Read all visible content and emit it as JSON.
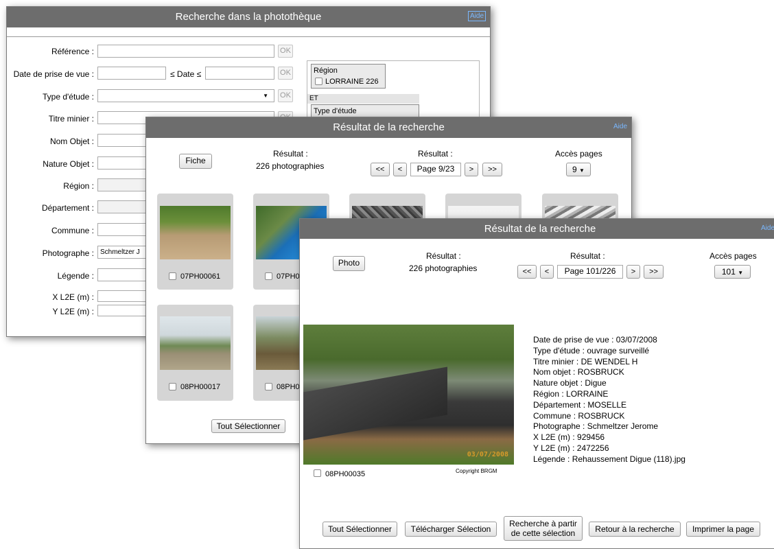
{
  "search": {
    "title": "Recherche dans la photothèque",
    "aide": "Aide",
    "labels": {
      "reference": "Référence :",
      "date": "Date de prise de vue :",
      "date_between": "≤ Date ≤",
      "type_etude": "Type d'étude :",
      "titre_minier": "Titre minier :",
      "nom_objet": "Nom Objet :",
      "nature_objet": "Nature Objet :",
      "region": "Région :",
      "departement": "Département :",
      "commune": "Commune :",
      "photographe": "Photographe :",
      "legende": "Légende :",
      "x": "X L2E (m) :",
      "y": "Y L2E (m) :"
    },
    "ok": "OK",
    "photographe_value": "Schmeltzer J",
    "criteria": {
      "region_title": "Région",
      "region_value": "LORRAINE 226",
      "et": "ET",
      "type_etude": "Type d'étude"
    }
  },
  "result1": {
    "title": "Résultat de la recherche",
    "aide": "Aide",
    "fiche": "Fiche",
    "resultat_label": "Résultat :",
    "count": "226 photographies",
    "pager_label": "Résultat :",
    "first": "<<",
    "prev": "<",
    "page": "Page 9/23",
    "next": ">",
    "last": ">>",
    "acces_label": "Accès pages",
    "acces_value": "9",
    "photos": [
      "07PH00061",
      "07PH0",
      "08PH00017",
      "08PH0"
    ],
    "tout_selectionner": "Tout Sélectionner"
  },
  "result2": {
    "title": "Résultat de la recherche",
    "aide": "Aide",
    "photo_btn": "Photo",
    "resultat_label": "Résultat :",
    "count": "226 photographies",
    "pager_label": "Résultat :",
    "first": "<<",
    "prev": "<",
    "page": "Page 101/226",
    "next": ">",
    "last": ">>",
    "acces_label": "Accès pages",
    "acces_value": "101",
    "photo_code": "08PH00035",
    "copyright": "Copyright BRGM",
    "photo_date_stamp": "03/07/2008",
    "details": [
      "Date de prise de vue : 03/07/2008",
      "Type d'étude : ouvrage surveillé",
      "Titre minier : DE WENDEL H",
      "Nom objet : ROSBRUCK",
      "Nature objet : Digue",
      "Région : LORRAINE",
      "Département : MOSELLE",
      "Commune : ROSBRUCK",
      "Photographe : Schmeltzer Jerome",
      "X L2E (m) : 929456",
      "Y L2E (m) : 2472256",
      "Légende : Rehaussement Digue (118).jpg"
    ],
    "buttons": {
      "tout": "Tout Sélectionner",
      "telecharger": "Télécharger Sélection",
      "recherche_line1": "Recherche à partir",
      "recherche_line2": "de cette sélection",
      "retour": "Retour à la recherche",
      "imprimer": "Imprimer la page"
    }
  },
  "icons": {
    "dropdown": "triangle-down-icon",
    "checkbox": "checkbox-icon"
  },
  "colors": {
    "titlebar": "#6d6d6d",
    "aide": "#7ab8ff",
    "card": "#d5d5d5"
  }
}
